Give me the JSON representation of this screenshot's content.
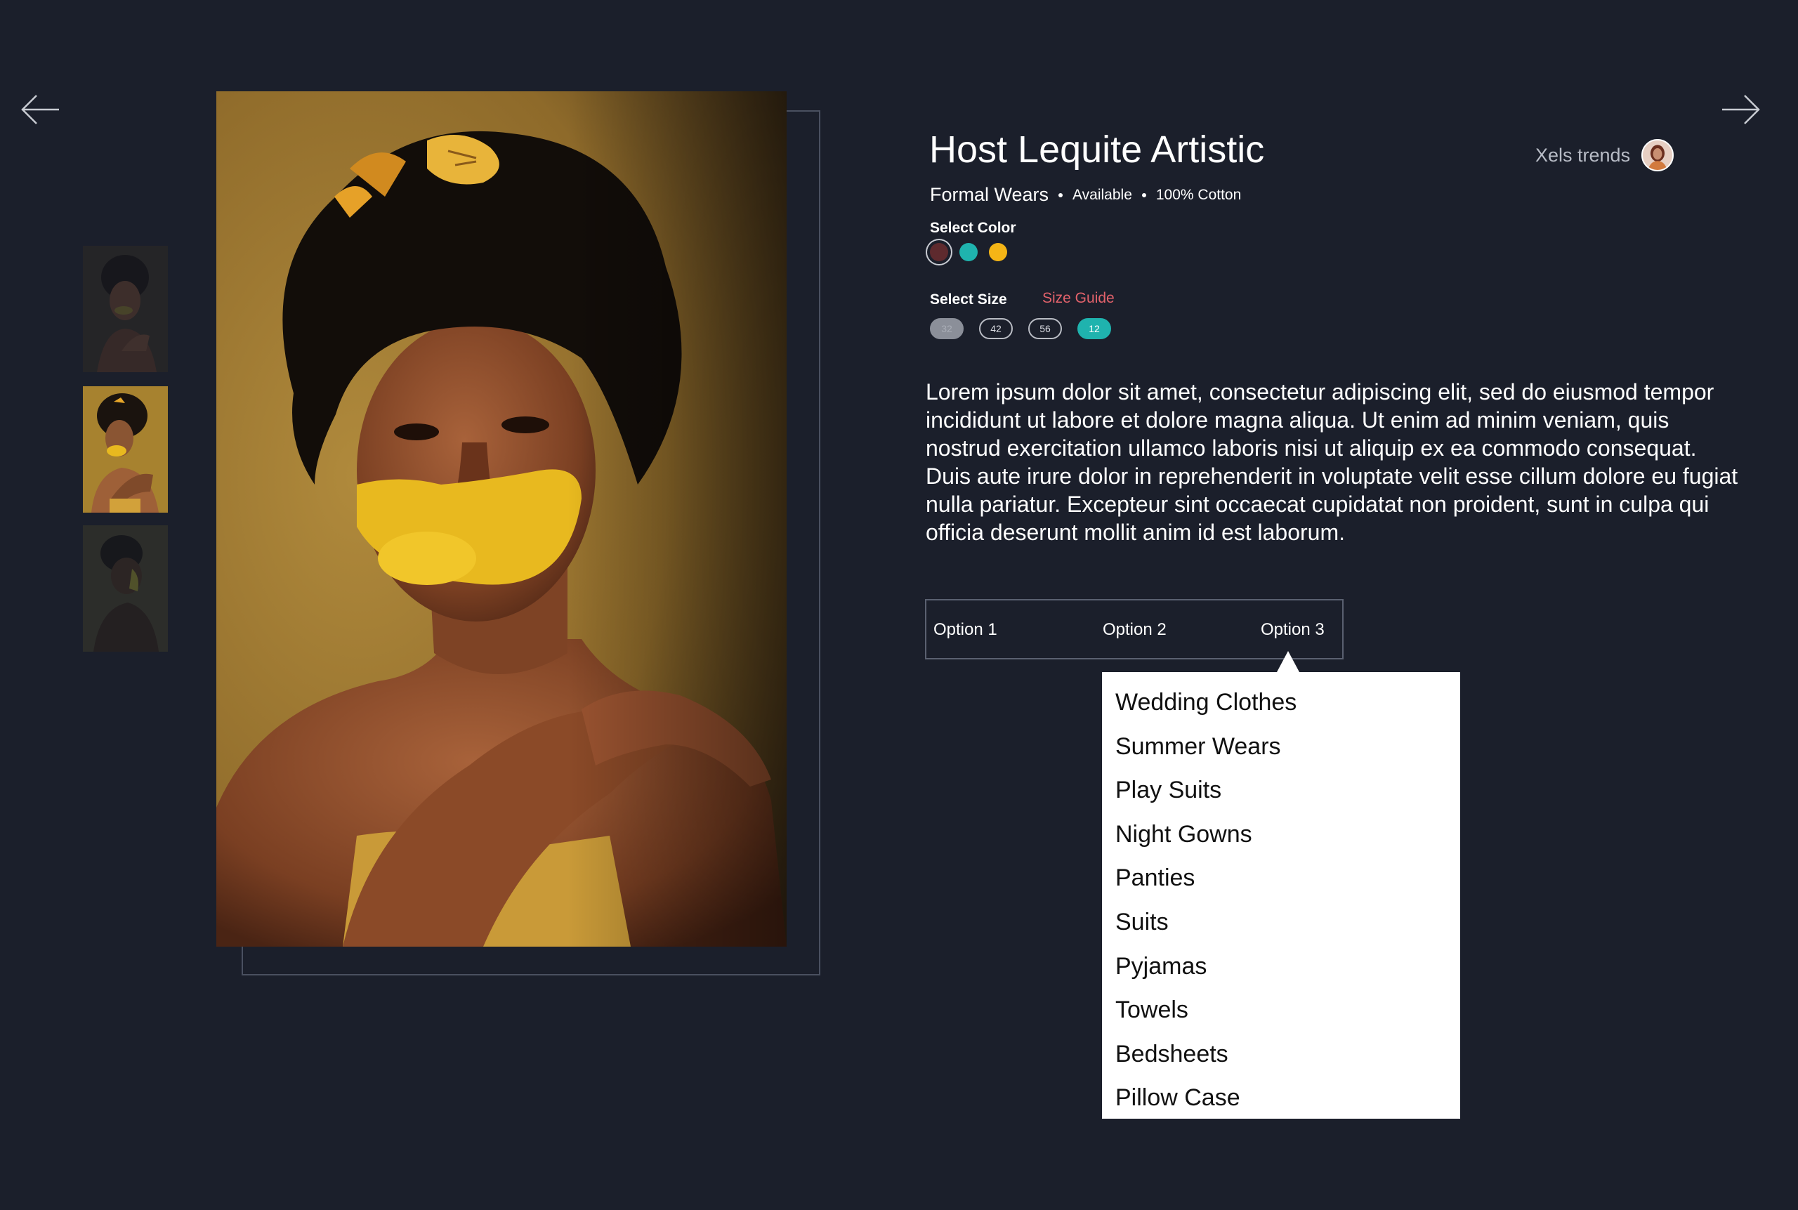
{
  "navigation": {
    "prev_icon": "arrow-left-icon",
    "next_icon": "arrow-right-icon"
  },
  "gallery": {
    "thumbnails": [
      {
        "alt": "Model photo 1",
        "selected": false
      },
      {
        "alt": "Model photo 2",
        "selected": true
      },
      {
        "alt": "Model photo 3",
        "selected": false
      }
    ]
  },
  "product": {
    "title": "Host Lequite Artistic",
    "category": "Formal Wears",
    "availability": "Available",
    "material": "100% Cotton",
    "brand": "Xels trends",
    "description": "Lorem ipsum dolor sit amet, consectetur adipiscing elit, sed do eiusmod tempor incididunt ut labore et dolore magna aliqua. Ut enim ad minim veniam, quis nostrud exercitation ullamco laboris nisi ut aliquip ex ea commodo consequat. Duis aute irure dolor in reprehenderit in voluptate velit esse cillum dolore eu fugiat nulla pariatur. Excepteur sint occaecat cupidatat non proident, sunt in culpa qui officia deserunt mollit anim id est laborum."
  },
  "color_select": {
    "label": "Select Color",
    "colors": [
      "#5e2a2e",
      "#1fb3ae",
      "#f5b516"
    ],
    "selected_index": 0
  },
  "size_select": {
    "label": "Select Size",
    "guide_label": "Size Guide",
    "sizes": [
      "32",
      "42",
      "56",
      "12"
    ],
    "disabled": "32",
    "selected": "12"
  },
  "options": {
    "tabs": [
      "Option 1",
      "Option 2",
      "Option 3"
    ],
    "active": "Option 3"
  },
  "dropdown": {
    "items": [
      "Wedding Clothes",
      "Summer Wears",
      "Play Suits",
      "Night Gowns",
      "Panties",
      "Suits",
      "Pyjamas",
      "Towels",
      "Bedsheets",
      "Pillow Case"
    ]
  }
}
